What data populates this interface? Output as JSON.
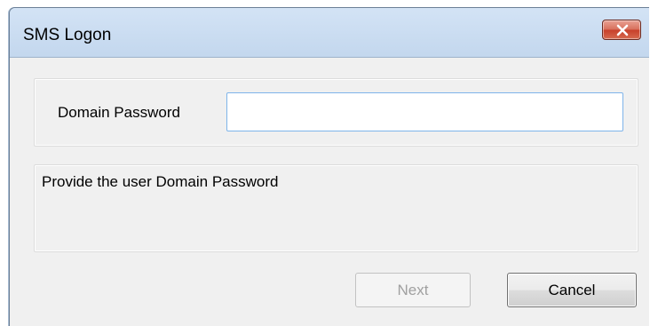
{
  "window": {
    "title": "SMS Logon"
  },
  "form": {
    "password_label": "Domain Password",
    "password_value": "",
    "password_placeholder": ""
  },
  "info": {
    "message": "Provide the user Domain Password"
  },
  "buttons": {
    "next_label": "Next",
    "next_enabled": false,
    "cancel_label": "Cancel"
  },
  "icons": {
    "close": "close-icon"
  },
  "colors": {
    "titlebar": "#c9dcf1",
    "close_button": "#c7402a",
    "dialog_background": "#f0f0f0",
    "input_border_focus": "#7eb4ea",
    "disabled_text": "#a0a0a0"
  }
}
